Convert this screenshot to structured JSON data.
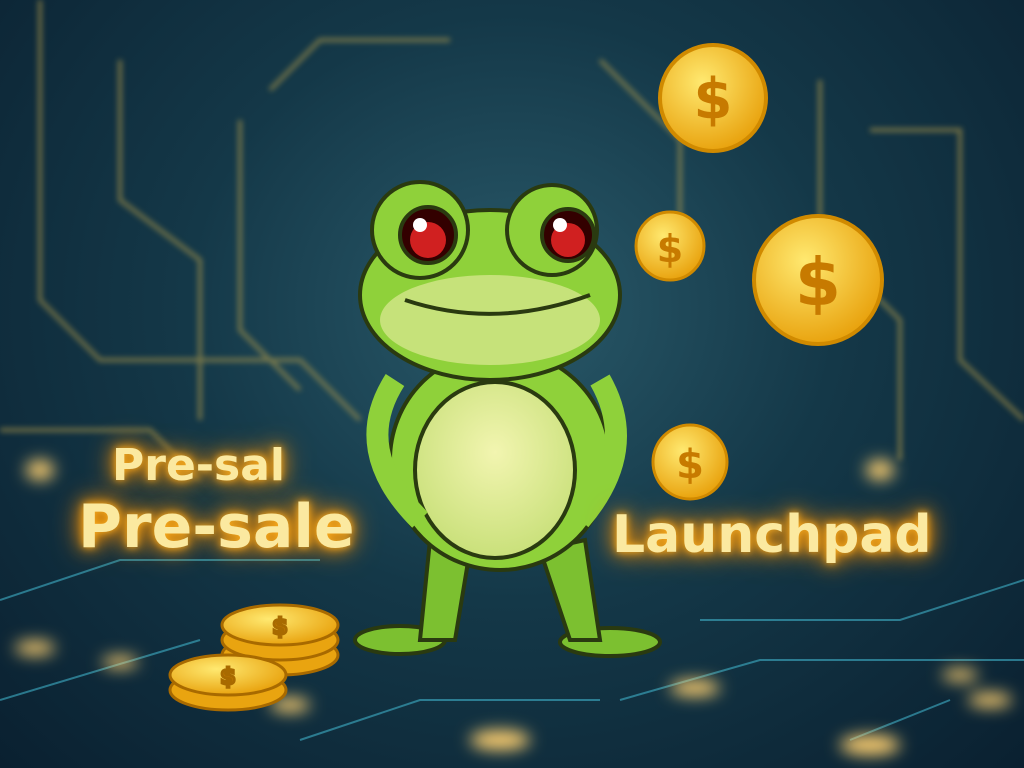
{
  "texts": {
    "line1": "Pre-sal",
    "line2": "Pre-sale",
    "launch": "Launchpad"
  },
  "coin_symbol": "$",
  "colors": {
    "bg": "#143848",
    "frog": "#8fd13a",
    "coin": "#f6c325",
    "glow": "#ffb020"
  }
}
